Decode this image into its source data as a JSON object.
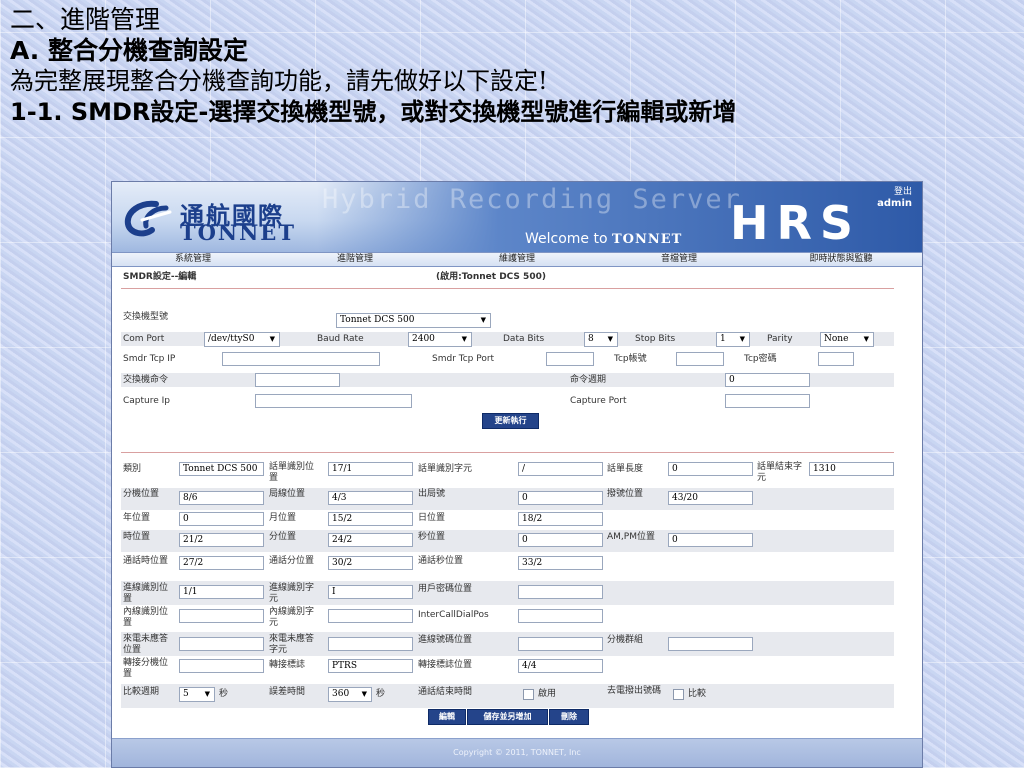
{
  "slide": {
    "line1": "二、進階管理",
    "line2": "A. 整合分機查詢設定",
    "line3": "為完整展現整合分機查詢功能，請先做好以下設定!",
    "line4": "1-1. SMDR設定-選擇交換機型號，或對交換機型號進行編輯或新增"
  },
  "header": {
    "logo_cn": "通航國際",
    "logo_en": "TONNET",
    "product_title": "Hybrid Recording Server",
    "welcome": "Welcome to",
    "welcome_brand": "TONNET",
    "hrs": "HRS",
    "logout": "登出",
    "user": "admin"
  },
  "nav": [
    "系統管理",
    "進階管理",
    "維護管理",
    "音檔管理",
    "即時狀態與監聽"
  ],
  "page": {
    "title": "SMDR設定--編輯",
    "model_in_use": "(啟用:Tonnet DCS 500)"
  },
  "top_form": {
    "pbx_model_label": "交換機型號",
    "pbx_model_value": "Tonnet DCS 500",
    "com_port_label": "Com Port",
    "com_port_value": "/dev/ttyS0",
    "baud_rate_label": "Baud Rate",
    "baud_rate_value": "2400",
    "data_bits_label": "Data Bits",
    "data_bits_value": "8",
    "stop_bits_label": "Stop Bits",
    "stop_bits_value": "1",
    "parity_label": "Parity",
    "parity_value": "None",
    "smdr_tcp_ip_label": "Smdr Tcp IP",
    "smdr_tcp_ip_value": "",
    "smdr_tcp_port_label": "Smdr Tcp Port",
    "smdr_tcp_port_value": "",
    "tcp_account_label": "Tcp帳號",
    "tcp_account_value": "",
    "tcp_password_label": "Tcp密碼",
    "tcp_password_value": "",
    "pbx_command_label": "交換機命令",
    "pbx_command_value": "",
    "command_period_label": "命令週期",
    "command_period_value": "0",
    "capture_ip_label": "Capture Ip",
    "capture_ip_value": "",
    "capture_port_label": "Capture Port",
    "capture_port_value": "",
    "refresh_button": "更新執行"
  },
  "detail_form": {
    "type_label": "類別",
    "type_value": "Tonnet DCS 500",
    "record_id_pos_label": "話單識別位置",
    "record_id_pos_value": "17/1",
    "record_id_char_label": "話單識別字元",
    "record_id_char_value": "/",
    "record_length_label": "話單長度",
    "record_length_value": "0",
    "record_end_char_label": "話單結束字元",
    "record_end_char_value": "1310",
    "ext_pos_label": "分機位置",
    "ext_pos_value": "8/6",
    "trunk_pos_label": "局線位置",
    "trunk_pos_value": "4/3",
    "out_trunk_label": "出局號",
    "out_trunk_value": "0",
    "dial_pos_label": "撥號位置",
    "dial_pos_value": "43/20",
    "year_pos_label": "年位置",
    "year_pos_value": "0",
    "month_pos_label": "月位置",
    "month_pos_value": "15/2",
    "day_pos_label": "日位置",
    "day_pos_value": "18/2",
    "hour_pos_label": "時位置",
    "hour_pos_value": "21/2",
    "minute_pos_label": "分位置",
    "minute_pos_value": "24/2",
    "second_pos_label": "秒位置",
    "second_pos_value": "0",
    "ampm_pos_label": "AM,PM位置",
    "ampm_pos_value": "0",
    "call_hour_pos_label": "通話時位置",
    "call_hour_pos_value": "27/2",
    "call_min_pos_label": "通話分位置",
    "call_min_pos_value": "30/2",
    "call_sec_pos_label": "通話秒位置",
    "call_sec_pos_value": "33/2",
    "in_trunk_id_pos_label": "進線識別位置",
    "in_trunk_id_pos_value": "1/1",
    "in_trunk_id_char_label": "進線識別字元",
    "in_trunk_id_char_value": "I",
    "user_pwd_pos_label": "用戶密碼位置",
    "user_pwd_pos_value": "",
    "internal_id_pos_label": "內線識別位置",
    "internal_id_pos_value": "",
    "internal_id_char_label": "內線識別字元",
    "internal_id_char_value": "",
    "intercall_label": "InterCallDialPos",
    "intercall_value": "",
    "unanswered_pos_label": "來電未應答位置",
    "unanswered_pos_value": "",
    "unanswered_char_label": "來電未應答字元",
    "unanswered_char_value": "",
    "in_number_pos_label": "進線號碼位置",
    "in_number_pos_value": "",
    "ext_group_label": "分機群組",
    "ext_group_value": "",
    "transfer_ext_pos_label": "轉接分機位置",
    "transfer_ext_pos_value": "",
    "transfer_flag_label": "轉接標誌",
    "transfer_flag_value": "PTRS",
    "transfer_flag_pos_label": "轉接標誌位置",
    "transfer_flag_pos_value": "4/4",
    "compare_period_label": "比較週期",
    "compare_period_value": "5",
    "compare_period_unit": "秒",
    "error_time_label": "誤差時間",
    "error_time_value": "360",
    "error_time_unit": "秒",
    "call_end_time_label": "通話結束時間",
    "call_end_time_check": "啟用",
    "out_dial_label": "去電撥出號碼",
    "out_dial_check": "比較",
    "edit_button": "編輯",
    "add_button": "儲存並另增加",
    "delete_button": "刪除"
  },
  "footer": {
    "copyright": "Copyright © 2011, TONNET, Inc"
  }
}
